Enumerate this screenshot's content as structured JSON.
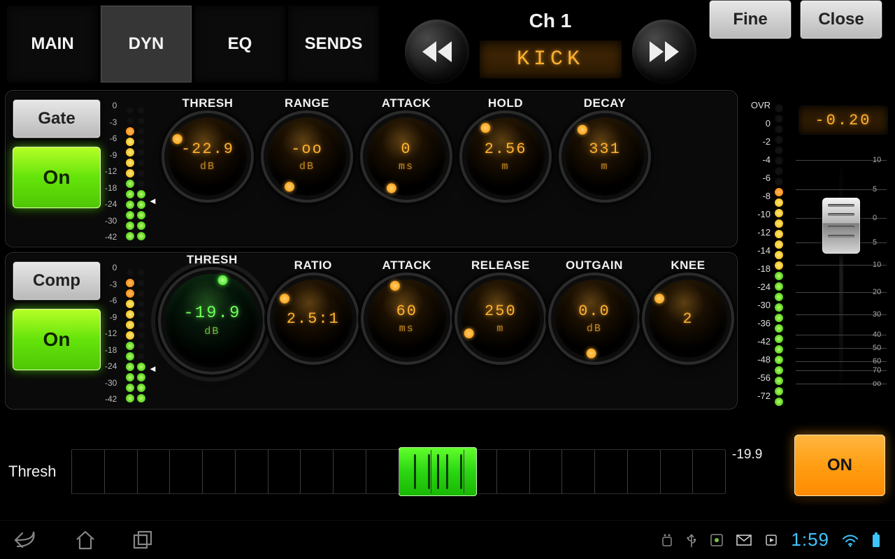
{
  "tabs": {
    "main": "MAIN",
    "dyn": "DYN",
    "eq": "EQ",
    "sends": "SENDS",
    "active": "DYN"
  },
  "channel": {
    "title": "Ch 1",
    "name": "KICK"
  },
  "top_buttons": {
    "fine": "Fine",
    "close": "Close"
  },
  "gate": {
    "label": "Gate",
    "on_label": "On",
    "scale": [
      "0",
      "-3",
      "-6",
      "-9",
      "-12",
      "-18",
      "-24",
      "-30",
      "-42"
    ],
    "knobs": [
      {
        "label": "THRESH",
        "value": "-22.9",
        "unit": "dB",
        "angle": -60
      },
      {
        "label": "RANGE",
        "value": "-oo",
        "unit": "dB",
        "angle": -150
      },
      {
        "label": "ATTACK",
        "value": "0",
        "unit": "ms",
        "angle": -155
      },
      {
        "label": "HOLD",
        "value": "2.56",
        "unit": "m",
        "angle": -35
      },
      {
        "label": "DECAY",
        "value": "331",
        "unit": "m",
        "angle": -40
      }
    ]
  },
  "comp": {
    "label": "Comp",
    "on_label": "On",
    "scale": [
      "0",
      "-3",
      "-6",
      "-9",
      "-12",
      "-18",
      "-24",
      "-30",
      "-42"
    ],
    "knobs": [
      {
        "label": "THRESH",
        "value": "-19.9",
        "unit": "dB",
        "angle": 15,
        "big": true
      },
      {
        "label": "RATIO",
        "value": "2.5:1",
        "unit": "",
        "angle": -55
      },
      {
        "label": "ATTACK",
        "value": "60",
        "unit": "ms",
        "angle": -20
      },
      {
        "label": "RELEASE",
        "value": "250",
        "unit": "m",
        "angle": -115
      },
      {
        "label": "OUTGAIN",
        "value": "0.0",
        "unit": "dB",
        "angle": -175
      },
      {
        "label": "KNEE",
        "value": "2",
        "unit": "",
        "angle": -55
      }
    ]
  },
  "right_meter": {
    "scale": [
      "OVR",
      "0",
      "-2",
      "-4",
      "-6",
      "-8",
      "-10",
      "-12",
      "-14",
      "-18",
      "-24",
      "-30",
      "-36",
      "-42",
      "-48",
      "-56",
      "-72"
    ]
  },
  "fader": {
    "value": "-0.20",
    "ticks": [
      {
        "pct": 0,
        "label": "10"
      },
      {
        "pct": 13,
        "label": "5"
      },
      {
        "pct": 26,
        "label": "0"
      },
      {
        "pct": 37,
        "label": "5"
      },
      {
        "pct": 47,
        "label": "10"
      },
      {
        "pct": 59,
        "label": "20"
      },
      {
        "pct": 69,
        "label": "30"
      },
      {
        "pct": 78,
        "label": "40"
      },
      {
        "pct": 84,
        "label": "50"
      },
      {
        "pct": 90,
        "label": "60"
      },
      {
        "pct": 94,
        "label": "70"
      },
      {
        "pct": 100,
        "label": "oo"
      }
    ],
    "position_pct": 20
  },
  "bottom": {
    "label": "Thresh",
    "value": "-19.9",
    "on_label": "ON",
    "handle_pct": 56
  },
  "android": {
    "clock": "1:59"
  }
}
